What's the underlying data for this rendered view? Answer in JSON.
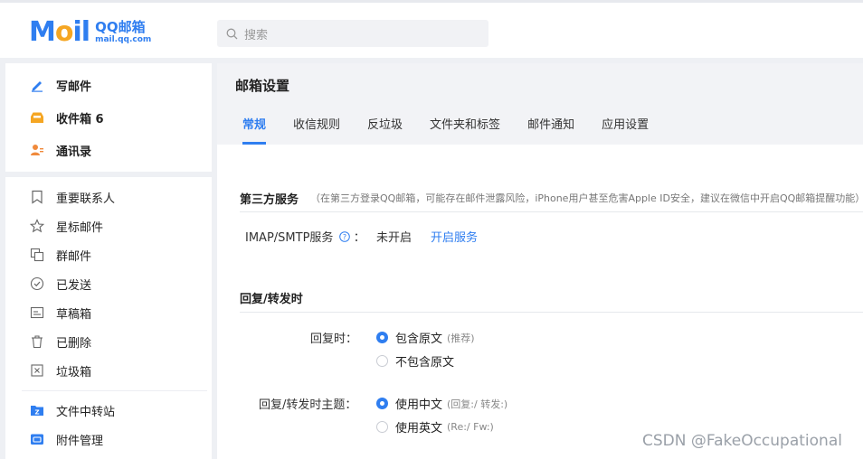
{
  "header": {
    "logo_mail": "M",
    "logo_o": "o",
    "logo_il": "il",
    "logo_qq": "QQ邮箱",
    "logo_url": "mail.qq.com",
    "search_placeholder": "搜索"
  },
  "sidebar": {
    "primary": [
      {
        "label": "写邮件",
        "icon": "pen-icon"
      },
      {
        "label": "收件箱 6",
        "icon": "inbox-icon"
      },
      {
        "label": "通讯录",
        "icon": "contacts-icon"
      }
    ],
    "folders": [
      {
        "label": "重要联系人",
        "icon": "bookmark-icon"
      },
      {
        "label": "星标邮件",
        "icon": "star-icon"
      },
      {
        "label": "群邮件",
        "icon": "group-mail-icon"
      },
      {
        "label": "已发送",
        "icon": "check-circle-icon"
      },
      {
        "label": "草稿箱",
        "icon": "draft-icon"
      },
      {
        "label": "已删除",
        "icon": "trash-icon"
      },
      {
        "label": "垃圾箱",
        "icon": "spam-icon"
      }
    ],
    "tools": [
      {
        "label": "文件中转站",
        "icon": "file-transfer-icon"
      },
      {
        "label": "附件管理",
        "icon": "attachment-icon"
      }
    ]
  },
  "main": {
    "title": "邮箱设置",
    "tabs": [
      "常规",
      "收信规则",
      "反垃圾",
      "文件夹和标签",
      "邮件通知",
      "应用设置"
    ],
    "active_tab": "常规",
    "third_party": {
      "title": "第三方服务",
      "note": "（在第三方登录QQ邮箱，可能存在邮件泄露风险，iPhone用户甚至危害Apple ID安全，建议在微信中开启QQ邮箱提醒功能）",
      "imap_label": "IMAP/SMTP服务",
      "colon": "：",
      "status": "未开启",
      "action": "开启服务"
    },
    "reply": {
      "title": "回复/转发时",
      "reply_label": "回复时：",
      "reply_options": [
        {
          "label": "包含原文",
          "hint": "(推荐)",
          "selected": true
        },
        {
          "label": "不包含原文",
          "hint": "",
          "selected": false
        }
      ],
      "subject_label": "回复/转发时主题：",
      "subject_options": [
        {
          "label": "使用中文",
          "hint": "(回复:/ 转发:)",
          "selected": true
        },
        {
          "label": "使用英文",
          "hint": "(Re:/ Fw:)",
          "selected": false
        }
      ]
    }
  },
  "watermark": "CSDN @FakeOccupational",
  "colors": {
    "accent": "#2f7ef0",
    "inbox_icon": "#f5a623",
    "contacts_icon": "#f08a3c"
  }
}
